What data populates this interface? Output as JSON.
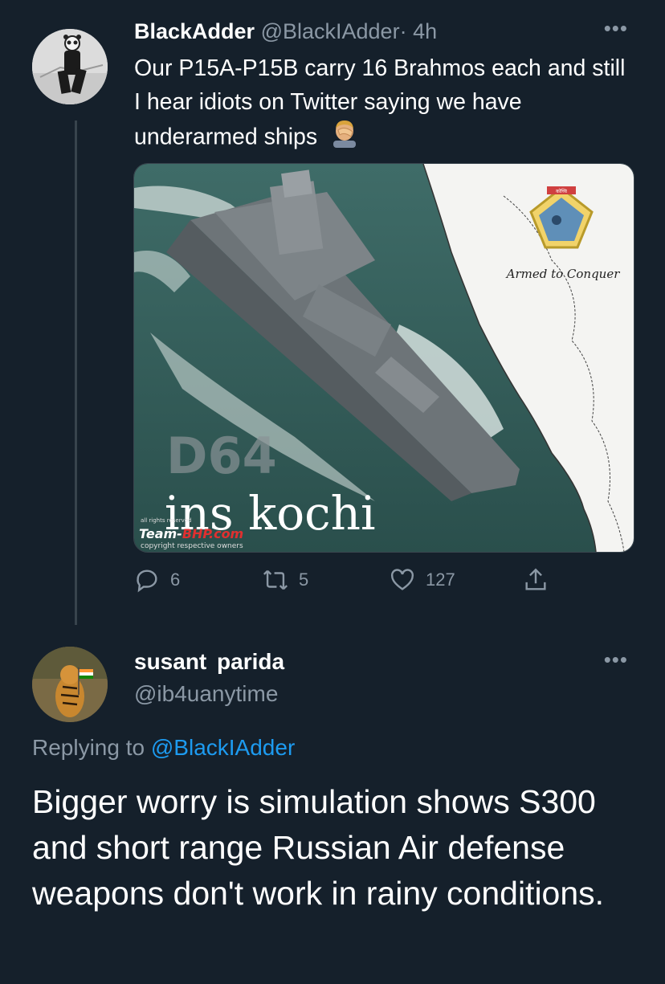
{
  "tweet1": {
    "display_name": "BlackAdder",
    "handle": "@BlackIAdder",
    "separator": "·",
    "time": "4h",
    "more_label": "•••",
    "text": "Our P15A-P15B carry 16 Brahmos each and still I hear idiots on Twitter saying we have underarmed ships",
    "media": {
      "hull_number": "D64",
      "ship_name": "ins kochi",
      "motto": "Armed to Conquer",
      "watermark_brand_a": "Team-",
      "watermark_brand_b": "BHP",
      "watermark_brand_c": ".com",
      "watermark_copyright": "copyright respective owners",
      "watermark_reserved": "all rights reserved",
      "crest_banner": "कोच्चि"
    },
    "actions": {
      "replies": "6",
      "retweets": "5",
      "likes": "127"
    }
  },
  "tweet2": {
    "display_name": "susant  parida",
    "handle": "@ib4uanytime",
    "more_label": "•••",
    "replying_prefix": "Replying to",
    "replying_to": "@BlackIAdder",
    "text": "Bigger worry is simulation shows S300 and short range Russian Air defense weapons don't work in rainy conditions."
  },
  "colors": {
    "background": "#15202b",
    "muted_text": "#8b98a5",
    "link": "#1d9bf0",
    "thread_line": "#38444d"
  },
  "icons": [
    "reply-icon",
    "retweet-icon",
    "like-icon",
    "share-icon",
    "more-icon",
    "facepalm-emoji"
  ]
}
